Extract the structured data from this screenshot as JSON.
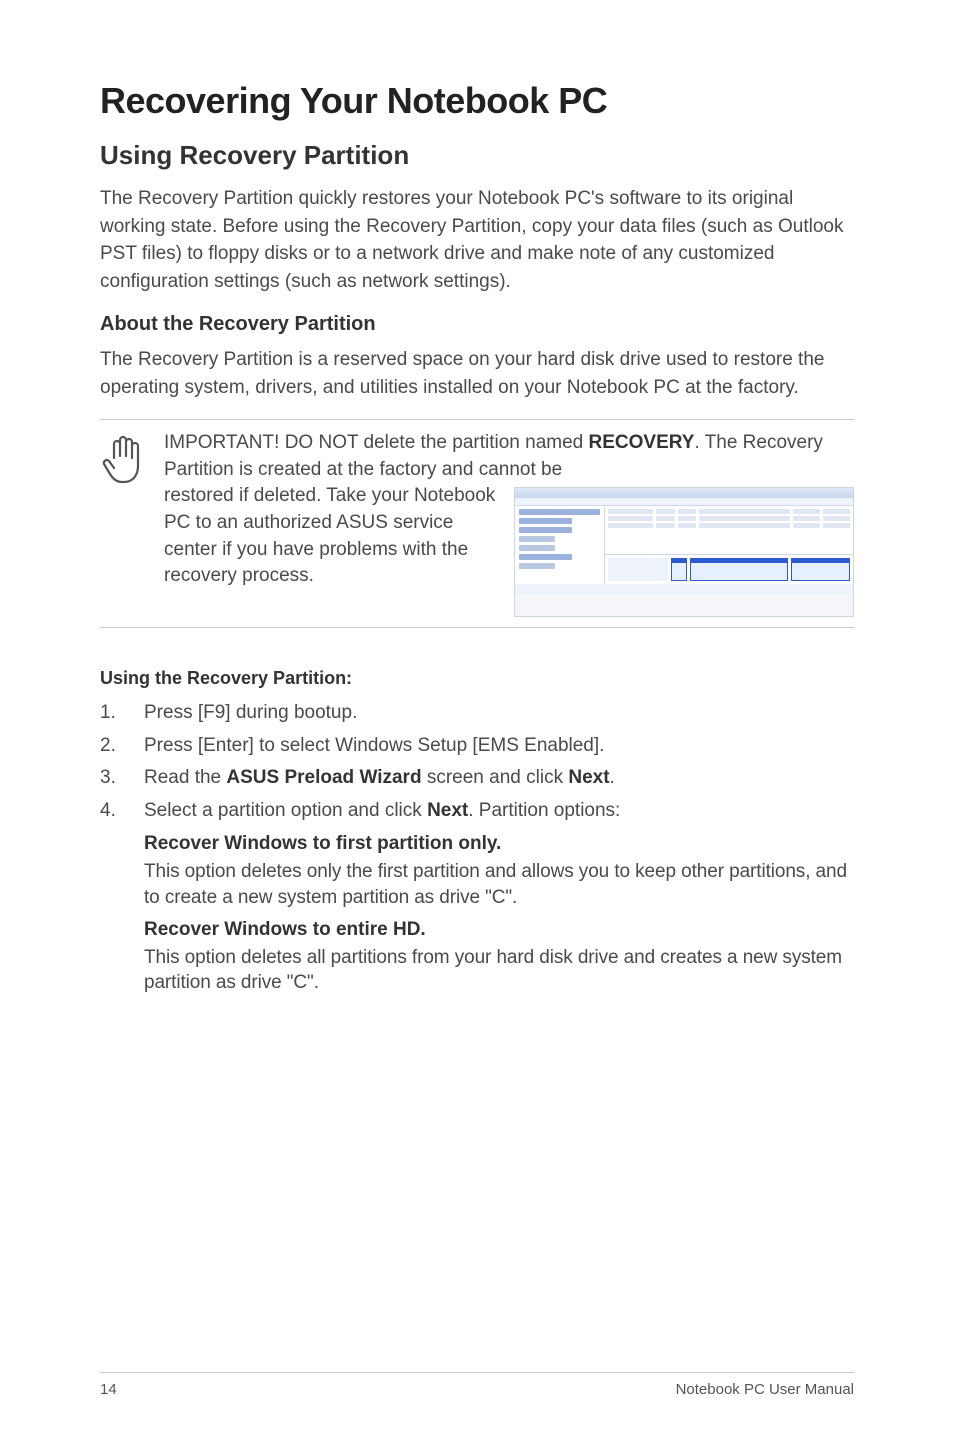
{
  "title": "Recovering Your Notebook PC",
  "section1": {
    "heading": "Using Recovery Partition",
    "para": "The Recovery Partition quickly restores your Notebook PC's software to its original working state. Before using the Recovery Partition, copy your data files (such as Outlook PST files) to floppy disks or to a network drive and make note of any customized configuration settings (such as network settings)."
  },
  "section2": {
    "heading": "About the Recovery Partition",
    "para": "The Recovery Partition is a reserved space on your hard disk drive used to restore the operating system, drivers, and utilities installed on your Notebook PC at the factory."
  },
  "note": {
    "line1a": "IMPORTANT! DO NOT delete the partition named ",
    "line1b": "RECOVERY",
    "line1c": ". The Recovery Partition is created at the factory and cannot be ",
    "line2": "restored if deleted. Take your Notebook PC to an authorized ASUS service center if you have problems with the recovery process."
  },
  "steps_heading": "Using the Recovery Partition:",
  "steps": {
    "s1": "Press [F9] during bootup.",
    "s2": "Press [Enter] to select Windows Setup [EMS Enabled].",
    "s3a": "Read the ",
    "s3b": "ASUS Preload Wizard",
    "s3c": " screen and click ",
    "s3d": "Next",
    "s3e": ".",
    "s4a": "Select a partition option and click ",
    "s4b": "Next",
    "s4c": ". Partition options:"
  },
  "opt1": {
    "title": "Recover Windows to first partition only.",
    "desc": "This option deletes only the first partition and allows you to keep other partitions, and to create a new system partition as drive \"C\"."
  },
  "opt2": {
    "title": "Recover Windows to entire HD.",
    "desc": "This option deletes all partitions from your hard disk drive and creates a new system partition as drive \"C\"."
  },
  "footer": {
    "page": "14",
    "manual": "Notebook PC User Manual"
  }
}
